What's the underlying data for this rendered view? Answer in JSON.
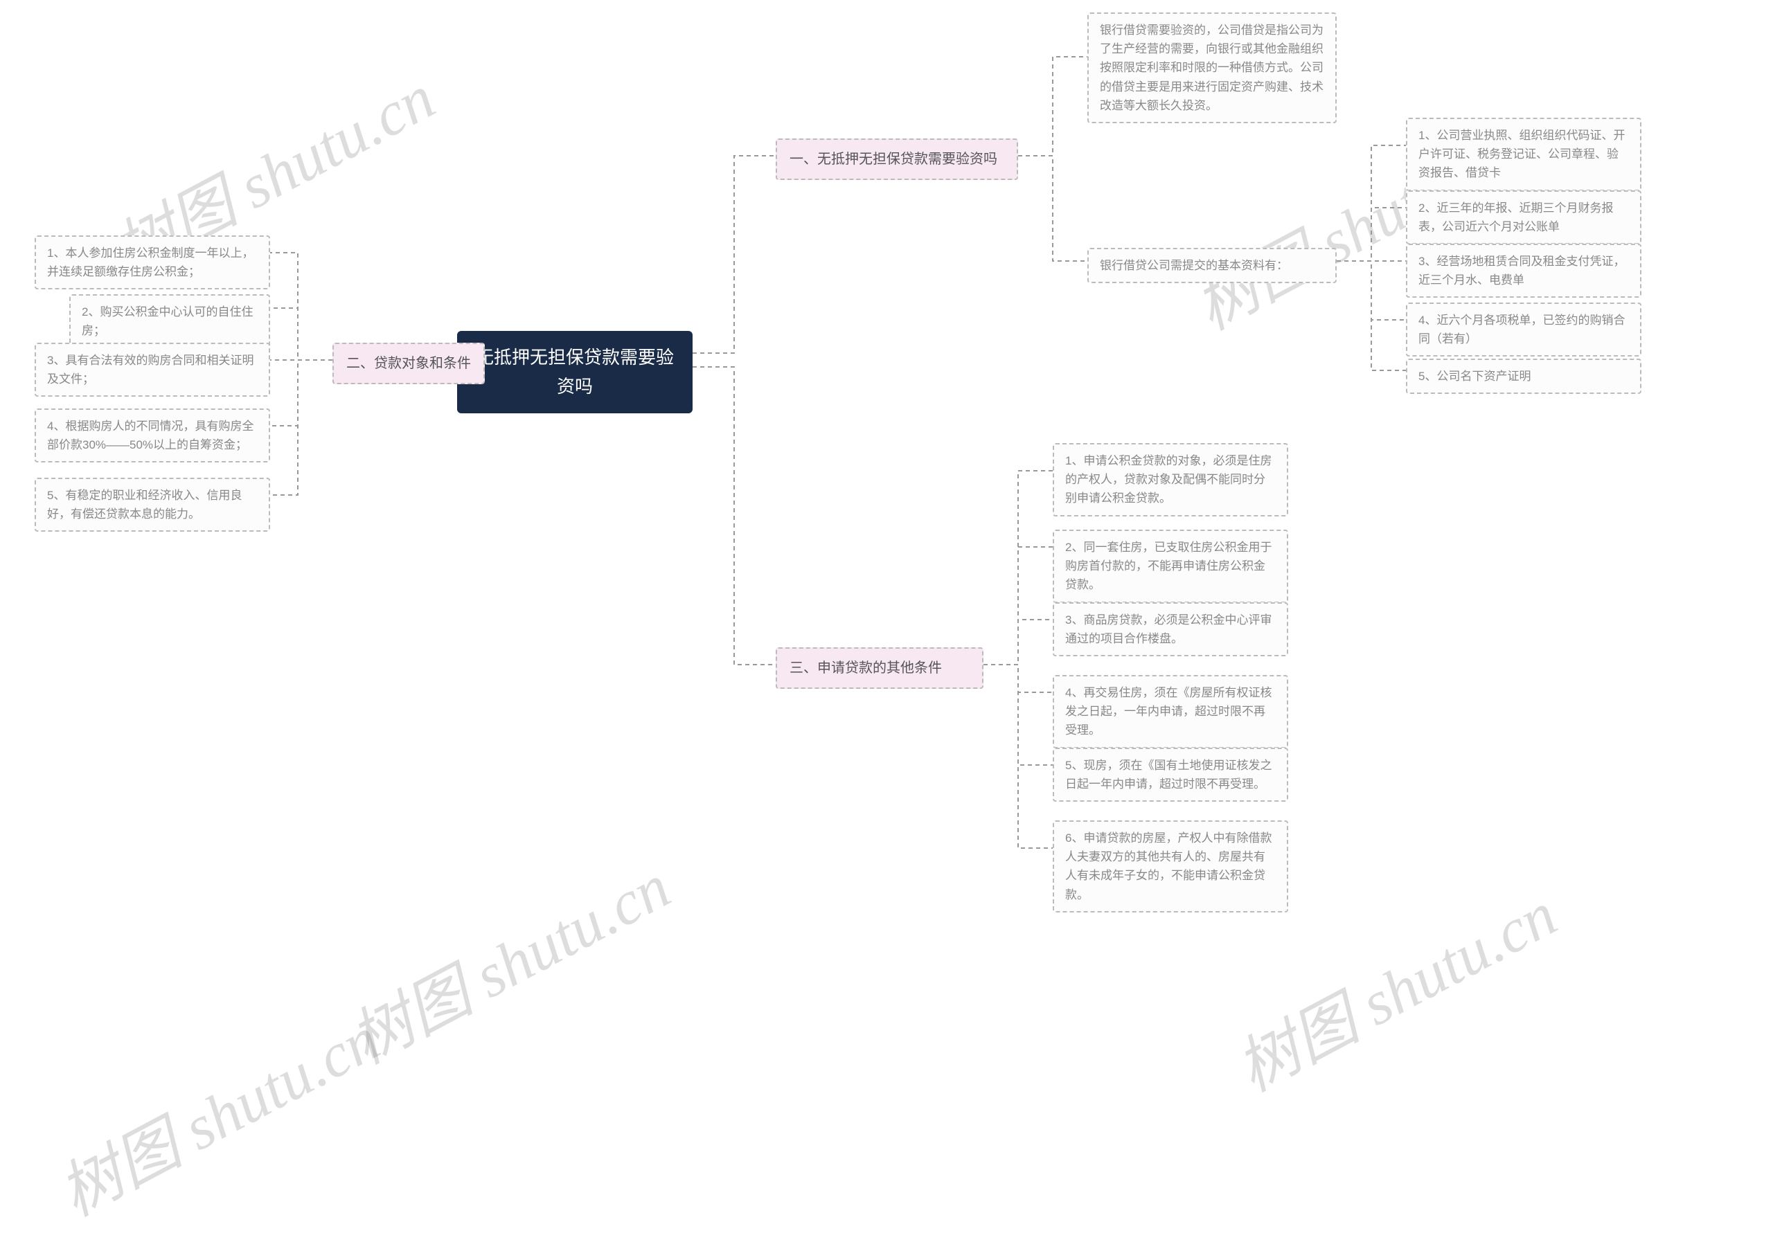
{
  "root": {
    "title": "无抵押无担保贷款需要验资吗"
  },
  "branch1": {
    "label": "一、无抵押无担保贷款需要验资吗",
    "leaf_intro": "银行借贷需要验资的，公司借贷是指公司为了生产经营的需要，向银行或其他金融组织按照限定利率和时限的一种借债方式。公司的借贷主要是用来进行固定资产购建、技术改造等大额长久投资。",
    "leaf_docs_title": "银行借贷公司需提交的基本资料有：",
    "docs": {
      "d1": "1、公司营业执照、组织组织代码证、开户许可证、税务登记证、公司章程、验资报告、借贷卡",
      "d2": "2、近三年的年报、近期三个月财务报表，公司近六个月对公账单",
      "d3": "3、经营场地租赁合同及租金支付凭证，近三个月水、电费单",
      "d4": "4、近六个月各项税单，已签约的购销合同（若有）",
      "d5": "5、公司名下资产证明"
    }
  },
  "branch2": {
    "label": "二、贷款对象和条件",
    "items": {
      "i1": "1、本人参加住房公积金制度一年以上，并连续足额缴存住房公积金；",
      "i2": "2、购买公积金中心认可的自住住房；",
      "i3": "3、具有合法有效的购房合同和相关证明及文件；",
      "i4": "4、根据购房人的不同情况，具有购房全部价款30%——50%以上的自筹资金；",
      "i5": "5、有稳定的职业和经济收入、信用良好，有偿还贷款本息的能力。"
    }
  },
  "branch3": {
    "label": "三、申请贷款的其他条件",
    "items": {
      "c1": "1、申请公积金贷款的对象，必须是住房的产权人，贷款对象及配偶不能同时分别申请公积金贷款。",
      "c2": "2、同一套住房，已支取住房公积金用于购房首付款的，不能再申请住房公积金贷款。",
      "c3": "3、商品房贷款，必须是公积金中心评审通过的项目合作楼盘。",
      "c4": "4、再交易住房，须在《房屋所有权证核发之日起，一年内申请，超过时限不再受理。",
      "c5": "5、现房，须在《国有土地使用证核发之日起一年内申请，超过时限不再受理。",
      "c6": "6、申请贷款的房屋，产权人中有除借款人夫妻双方的其他共有人的、房屋共有人有未成年子女的，不能申请公积金贷款。"
    }
  },
  "watermark": "树图 shutu.cn"
}
